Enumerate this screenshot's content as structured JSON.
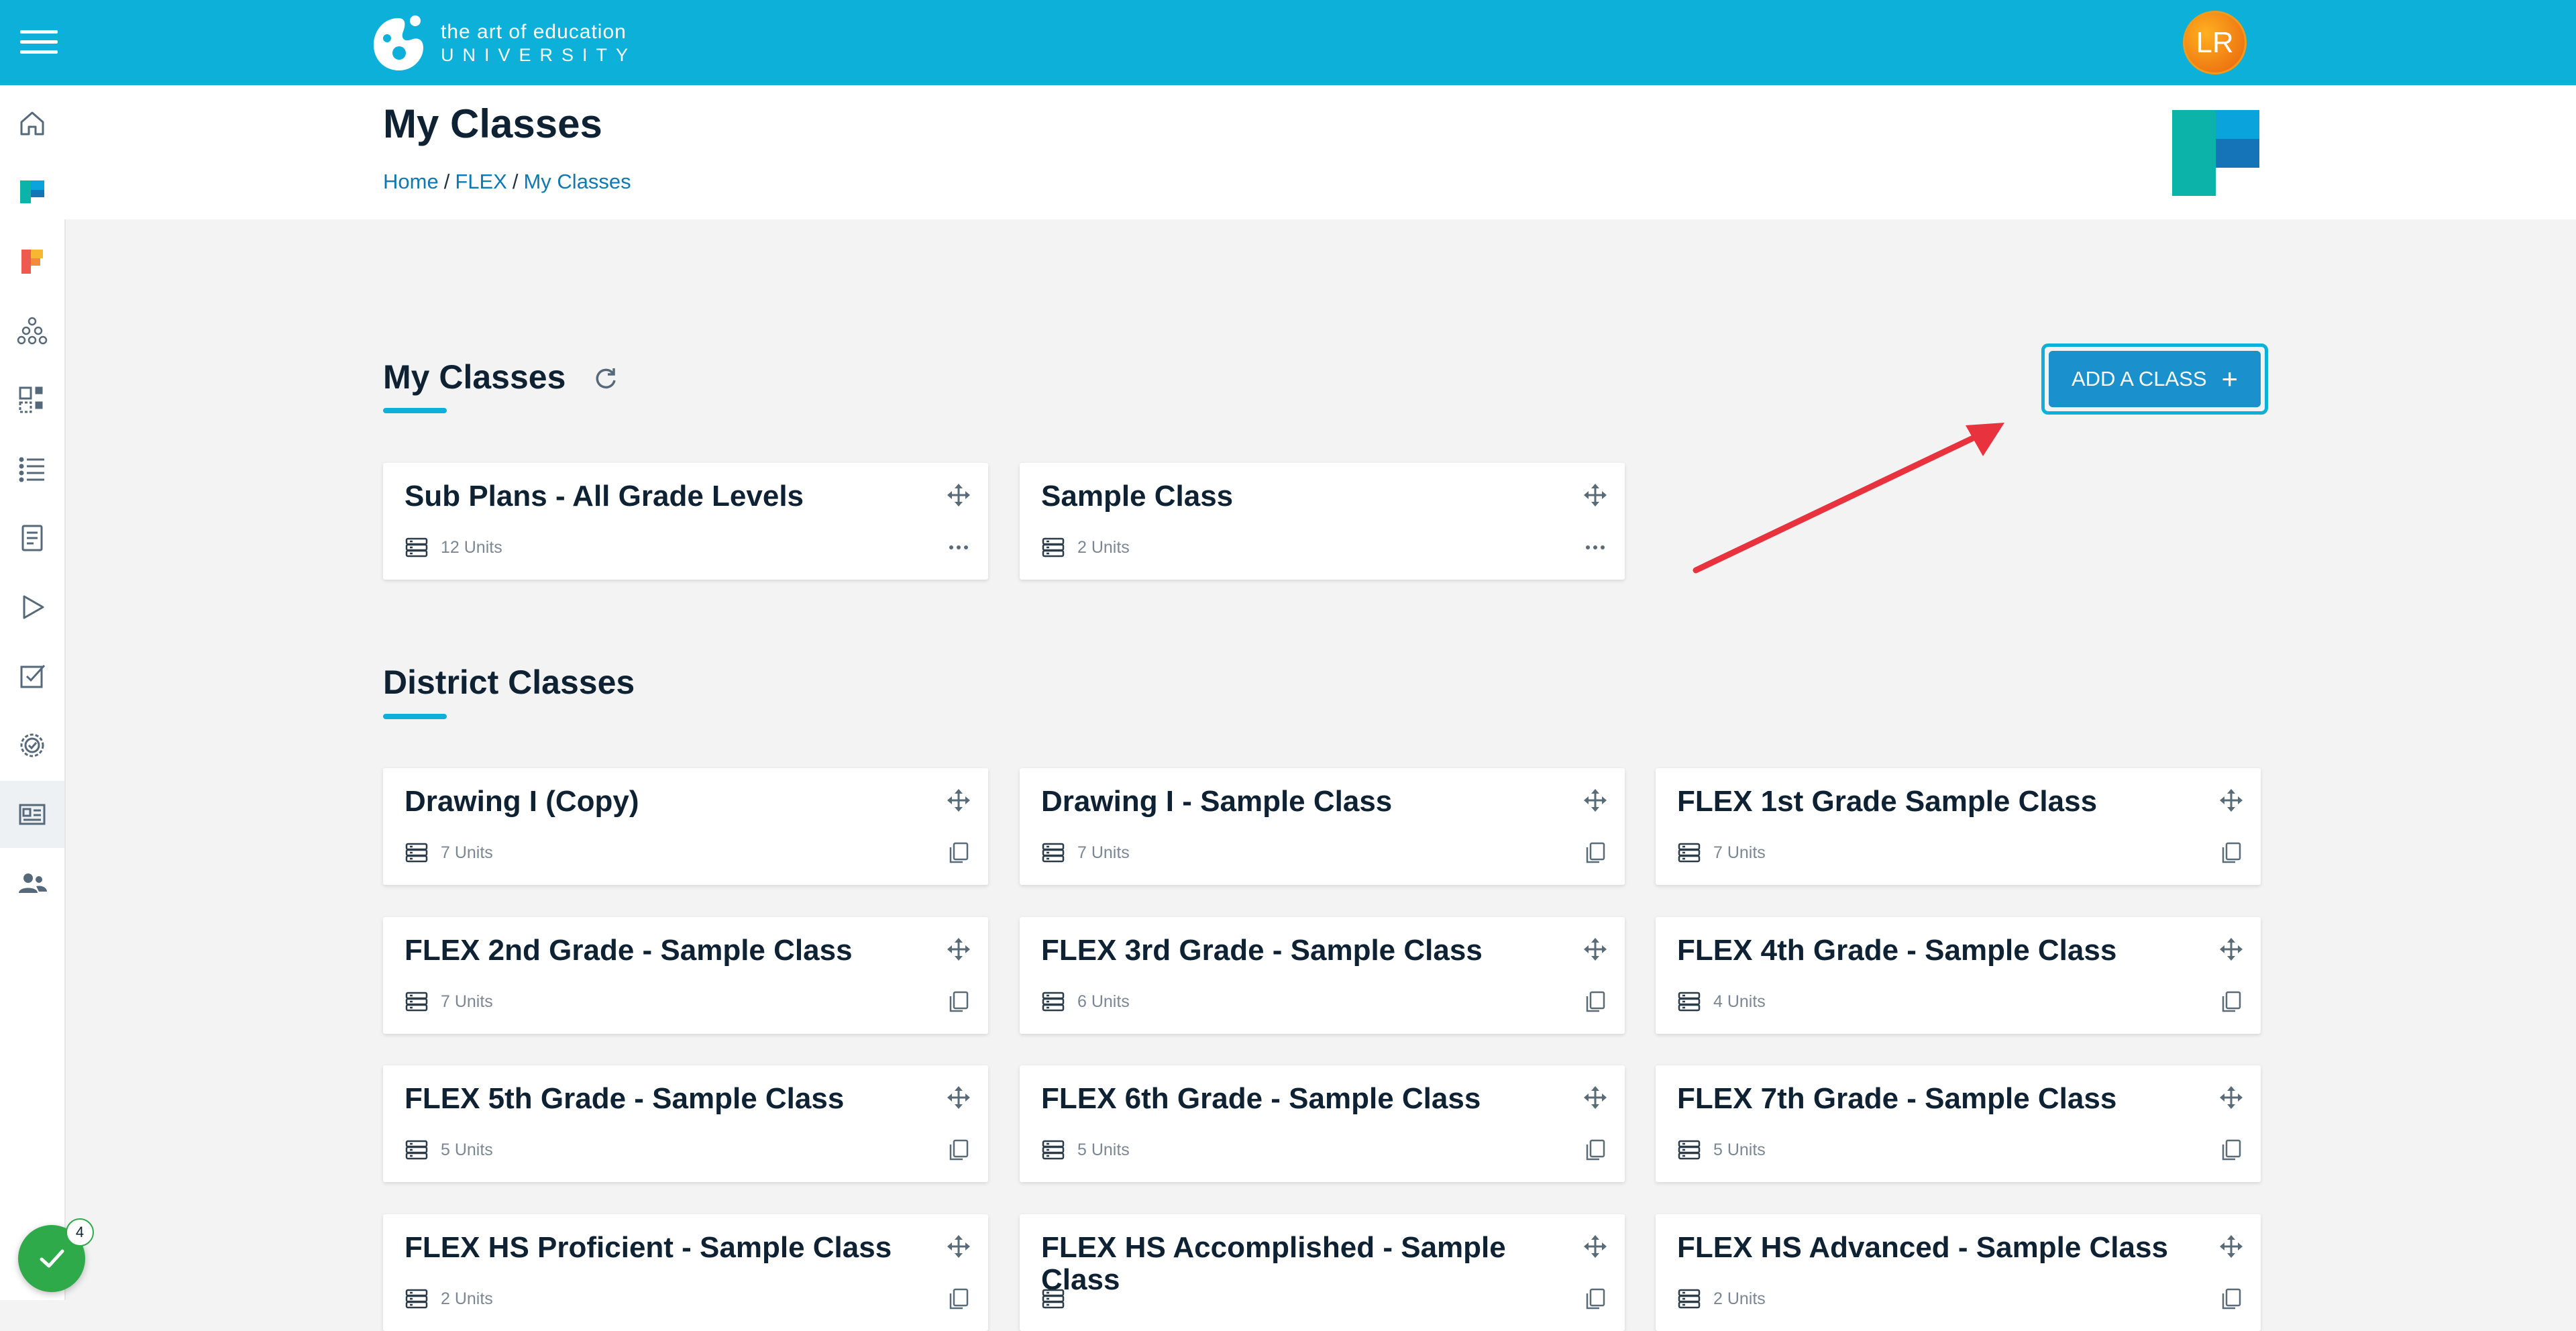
{
  "topbar": {
    "logo_line1": "the art of education",
    "logo_line2": "UNIVERSITY",
    "avatar_initials": "LR"
  },
  "sidebar": {
    "items": [
      "home-icon",
      "flex-icon",
      "pro-icon",
      "network-icon",
      "widgets-icon",
      "list-icon",
      "document-icon",
      "play-icon",
      "checkbox-icon",
      "badge-icon",
      "classes-icon",
      "users-icon"
    ],
    "active": "classes-icon"
  },
  "header": {
    "title": "My Classes",
    "breadcrumb": [
      "Home",
      "FLEX",
      "My Classes"
    ]
  },
  "my_classes": {
    "title": "My Classes",
    "add_button": "ADD A CLASS",
    "cards": [
      {
        "title": "Sub Plans - All Grade Levels",
        "units": "12 Units"
      },
      {
        "title": "Sample Class",
        "units": "2 Units"
      }
    ]
  },
  "district_classes": {
    "title": "District Classes",
    "cards": [
      {
        "title": "Drawing I (Copy)",
        "units": "7 Units"
      },
      {
        "title": "Drawing I - Sample Class",
        "units": "7 Units"
      },
      {
        "title": "FLEX 1st Grade Sample Class",
        "units": "7 Units"
      },
      {
        "title": "FLEX 2nd Grade - Sample Class",
        "units": "7 Units"
      },
      {
        "title": "FLEX 3rd Grade - Sample Class",
        "units": "6 Units"
      },
      {
        "title": "FLEX 4th Grade - Sample Class",
        "units": "4 Units"
      },
      {
        "title": "FLEX 5th Grade - Sample Class",
        "units": "5 Units"
      },
      {
        "title": "FLEX 6th Grade - Sample Class",
        "units": "5 Units"
      },
      {
        "title": "FLEX 7th Grade - Sample Class",
        "units": "5 Units"
      },
      {
        "title": "FLEX HS Proficient - Sample Class",
        "units": "2 Units"
      },
      {
        "title": "FLEX HS Accomplished - Sample Class",
        "units": ""
      },
      {
        "title": "FLEX HS Advanced - Sample Class",
        "units": "2 Units"
      }
    ]
  },
  "notifications": {
    "count": "4"
  },
  "colors": {
    "brand": "#0db0d8",
    "button": "#1a90cc",
    "title": "#0e2233",
    "success": "#2faa4a",
    "arrow": "#e8323e"
  }
}
